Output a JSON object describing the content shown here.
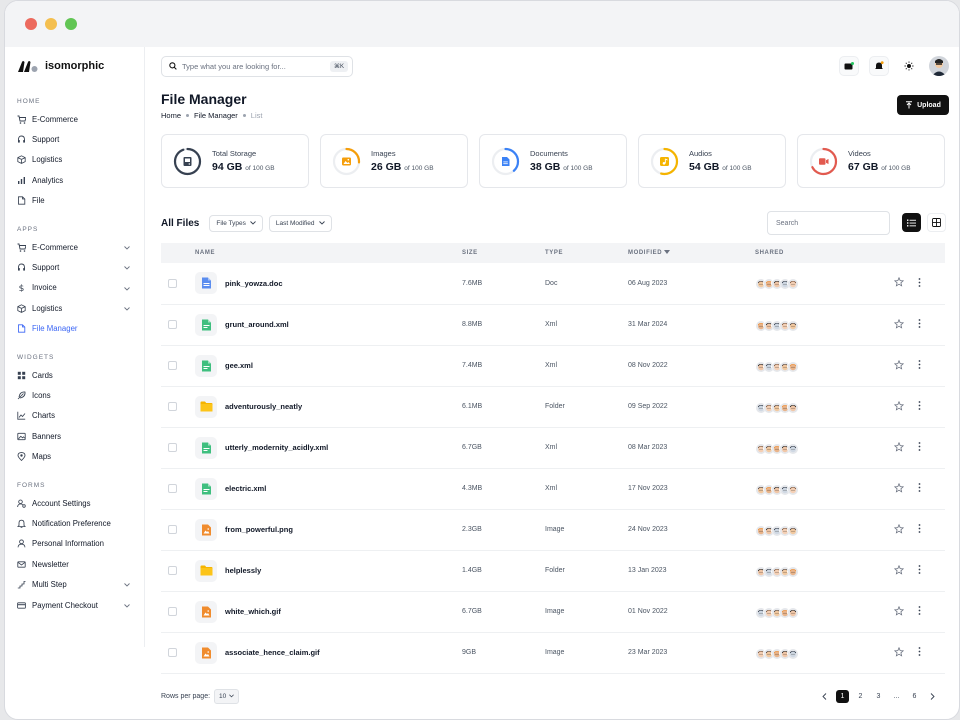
{
  "colors": {
    "red": "#ec6a5e",
    "yellow": "#f4bf4f",
    "green": "#61c554",
    "accent": "#3b66f5"
  },
  "brand": {
    "name": "isomorphic"
  },
  "sidebar": {
    "sections": [
      {
        "title": "HOME",
        "items": [
          {
            "label": "E-Commerce",
            "icon": "cart-icon"
          },
          {
            "label": "Support",
            "icon": "headset-icon"
          },
          {
            "label": "Logistics",
            "icon": "box-icon"
          },
          {
            "label": "Analytics",
            "icon": "analytics-icon"
          },
          {
            "label": "File",
            "icon": "file-icon"
          }
        ]
      },
      {
        "title": "APPS",
        "items": [
          {
            "label": "E-Commerce",
            "icon": "cart-icon",
            "chevron": true
          },
          {
            "label": "Support",
            "icon": "headset-icon",
            "chevron": true
          },
          {
            "label": "Invoice",
            "icon": "dollar-icon",
            "chevron": true
          },
          {
            "label": "Logistics",
            "icon": "box-icon",
            "chevron": true
          },
          {
            "label": "File Manager",
            "icon": "file-icon",
            "active": true
          }
        ]
      },
      {
        "title": "WIDGETS",
        "items": [
          {
            "label": "Cards",
            "icon": "grid-icon"
          },
          {
            "label": "Icons",
            "icon": "feather-icon"
          },
          {
            "label": "Charts",
            "icon": "chart-icon"
          },
          {
            "label": "Banners",
            "icon": "image-icon"
          },
          {
            "label": "Maps",
            "icon": "pin-icon"
          }
        ]
      },
      {
        "title": "FORMS",
        "items": [
          {
            "label": "Account Settings",
            "icon": "user-gear-icon"
          },
          {
            "label": "Notification Preference",
            "icon": "bell-icon"
          },
          {
            "label": "Personal Information",
            "icon": "user-icon"
          },
          {
            "label": "Newsletter",
            "icon": "mail-icon"
          },
          {
            "label": "Multi Step",
            "icon": "steps-icon",
            "chevron": true
          },
          {
            "label": "Payment Checkout",
            "icon": "card-icon",
            "chevron": true
          }
        ]
      }
    ]
  },
  "topbar": {
    "search_placeholder": "Type what you are looking for...",
    "shortcut": "⌘K"
  },
  "page": {
    "title": "File Manager",
    "breadcrumb": [
      "Home",
      "File Manager",
      "List"
    ],
    "upload_label": "Upload"
  },
  "storage": [
    {
      "label": "Total Storage",
      "value": "94 GB",
      "suffix": "of 100 GB",
      "color": "#374151",
      "fraction": 0.94,
      "icon": "hard-drive-icon"
    },
    {
      "label": "Images",
      "value": "26 GB",
      "suffix": "of 100 GB",
      "color": "#f59e0b",
      "fraction": 0.26,
      "icon": "image-icon"
    },
    {
      "label": "Documents",
      "value": "38 GB",
      "suffix": "of 100 GB",
      "color": "#3b82f6",
      "fraction": 0.38,
      "icon": "document-icon"
    },
    {
      "label": "Audios",
      "value": "54 GB",
      "suffix": "of 100 GB",
      "color": "#f5b400",
      "fraction": 0.54,
      "icon": "audio-icon"
    },
    {
      "label": "Videos",
      "value": "67 GB",
      "suffix": "of 100 GB",
      "color": "#e25a4f",
      "fraction": 0.67,
      "icon": "video-icon"
    }
  ],
  "files": {
    "title": "All Files",
    "filters": [
      "File Types",
      "Last Modified"
    ],
    "search_placeholder": "Search",
    "columns": [
      "NAME",
      "SIZE",
      "TYPE",
      "MODIFIED",
      "SHARED"
    ],
    "rows": [
      {
        "name": "pink_yowza.doc",
        "size": "7.6MB",
        "type": "Doc",
        "modified": "06 Aug 2023",
        "kind": "doc"
      },
      {
        "name": "grunt_around.xml",
        "size": "8.8MB",
        "type": "Xml",
        "modified": "31 Mar 2024",
        "kind": "xml"
      },
      {
        "name": "gee.xml",
        "size": "7.4MB",
        "type": "Xml",
        "modified": "08 Nov 2022",
        "kind": "xml"
      },
      {
        "name": "adventurously_neatly",
        "size": "6.1MB",
        "type": "Folder",
        "modified": "09 Sep 2022",
        "kind": "folder"
      },
      {
        "name": "utterly_modernity_acidly.xml",
        "size": "6.7GB",
        "type": "Xml",
        "modified": "08 Mar 2023",
        "kind": "xml"
      },
      {
        "name": "electric.xml",
        "size": "4.3MB",
        "type": "Xml",
        "modified": "17 Nov 2023",
        "kind": "xml"
      },
      {
        "name": "from_powerful.png",
        "size": "2.3GB",
        "type": "Image",
        "modified": "24 Nov 2023",
        "kind": "image"
      },
      {
        "name": "helplessly",
        "size": "1.4GB",
        "type": "Folder",
        "modified": "13 Jan 2023",
        "kind": "folder"
      },
      {
        "name": "white_which.gif",
        "size": "6.7GB",
        "type": "Image",
        "modified": "01 Nov 2022",
        "kind": "image"
      },
      {
        "name": "associate_hence_claim.gif",
        "size": "9GB",
        "type": "Image",
        "modified": "23 Mar 2023",
        "kind": "image"
      }
    ]
  },
  "footer": {
    "rows_label": "Rows per page:",
    "rows_value": "10",
    "pages": [
      "1",
      "2",
      "3",
      "...",
      "6"
    ],
    "current_page": "1"
  }
}
